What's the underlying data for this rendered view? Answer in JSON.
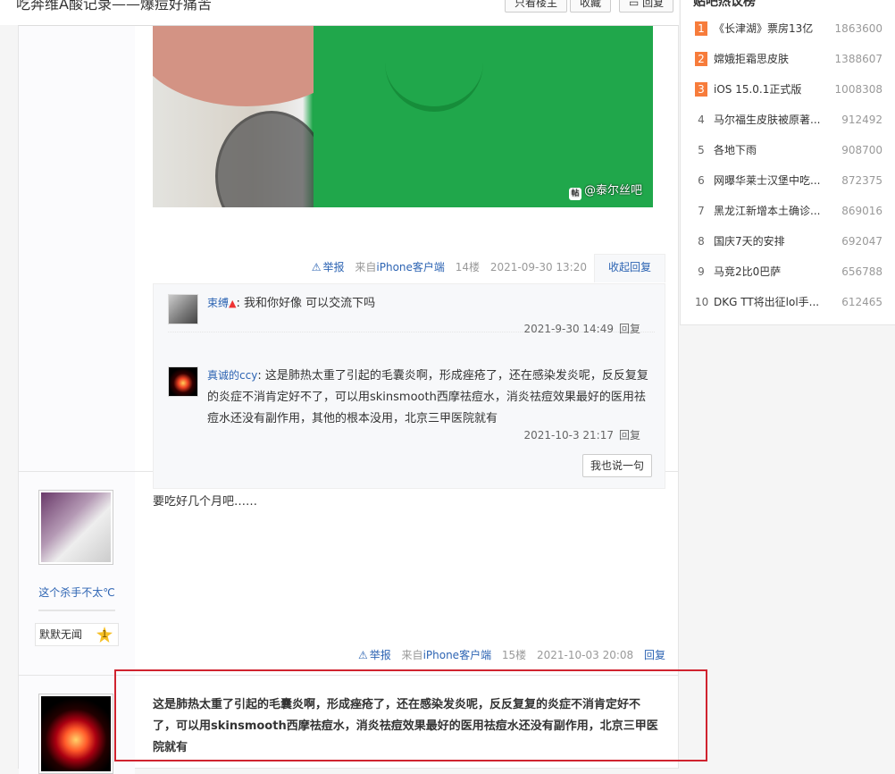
{
  "topbar": {
    "title": "吃奔维A酸记录——爆痘好痛苦",
    "btn_louzhu": "只看楼主",
    "btn_collect": "收藏",
    "btn_reply": "回复"
  },
  "post14": {
    "watermark": "@泰尔丝吧",
    "watermark_logo": "帖",
    "meta": {
      "report": "举报",
      "client_prefix": "来自",
      "client": "iPhone客户端",
      "floor": "14楼",
      "time": "2021-09-30 13:20"
    },
    "collapse": "收起回复",
    "replies": [
      {
        "name": "束缚",
        "text": ": 我和你好像 可以交流下吗",
        "time": "2021-9-30 14:49",
        "reply": "回复"
      },
      {
        "name": "真诚的ccy",
        "text": ": 这是肺热太重了引起的毛囊炎啊，形成痤疮了，还在感染发炎呢，反反复复的炎症不消肯定好不了，可以用skinsmooth西摩祛痘水，消炎祛痘效果最好的医用祛痘水还没有副作用，其他的根本没用，北京三甲医院就有",
        "time": "2021-10-3 21:17",
        "reply": "回复"
      }
    ],
    "say_btn": "我也说一句"
  },
  "post15": {
    "user": {
      "name": "这个杀手不太℃",
      "badge": "默默无闻",
      "level": "1"
    },
    "content": "要吃好几个月吧……",
    "meta": {
      "report": "举报",
      "client_prefix": "来自",
      "client": "iPhone客户端",
      "floor": "15楼",
      "time": "2021-10-03 20:08",
      "reply": "回复"
    }
  },
  "post16": {
    "content": "这是肺热太重了引起的毛囊炎啊，形成痤疮了，还在感染发炎呢，反反复复的炎症不消肯定好不了，可以用skinsmooth西摩祛痘水，消炎祛痘效果最好的医用祛痘水还没有副作用，北京三甲医院就有"
  },
  "sidebar": {
    "title": "贴吧热议榜",
    "items": [
      {
        "rank": "1",
        "title": "《长津湖》票房13亿",
        "count": "1863600"
      },
      {
        "rank": "2",
        "title": "嫦娥拒霜思皮肤",
        "count": "1388607"
      },
      {
        "rank": "3",
        "title": "iOS 15.0.1正式版",
        "count": "1008308"
      },
      {
        "rank": "4",
        "title": "马尔福生皮肤被原著...",
        "count": "912492"
      },
      {
        "rank": "5",
        "title": "各地下雨",
        "count": "908700"
      },
      {
        "rank": "6",
        "title": "网曝华莱士汉堡中吃...",
        "count": "872375"
      },
      {
        "rank": "7",
        "title": "黑龙江新增本土确诊...",
        "count": "869016"
      },
      {
        "rank": "8",
        "title": "国庆7天的安排",
        "count": "692047"
      },
      {
        "rank": "9",
        "title": "马竞2比0巴萨",
        "count": "656788"
      },
      {
        "rank": "10",
        "title": "DKG TT将出征lol手...",
        "count": "612465"
      }
    ]
  },
  "colors": {
    "link": "#2d64b3",
    "highlight": "#d0232f",
    "rank_top": "#f77c3b"
  }
}
